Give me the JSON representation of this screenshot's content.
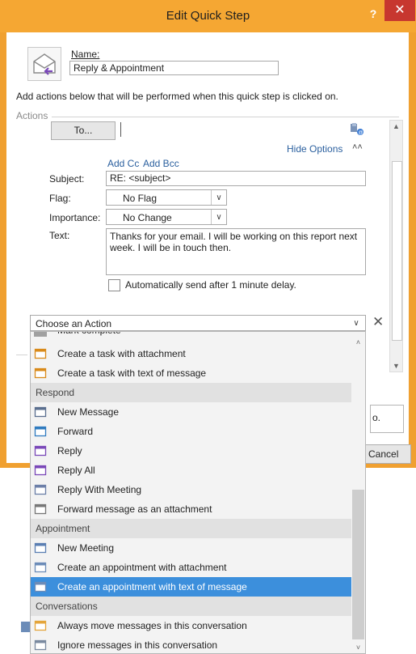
{
  "window": {
    "title": "Edit Quick Step",
    "help_label": "?",
    "close_label": "✕"
  },
  "name": {
    "label": "Name:",
    "value": "Reply & Appointment"
  },
  "instructions": "Add actions below that will be performed when this quick step is clicked on.",
  "actions_label": "Actions",
  "to_button": "To...",
  "hide_options": "Hide Options",
  "add_cc": "Add Cc",
  "add_bcc": "Add Bcc",
  "subject": {
    "label": "Subject:",
    "value": "RE: <subject>"
  },
  "flag": {
    "label": "Flag:",
    "value": "No Flag"
  },
  "importance": {
    "label": "Importance:",
    "value": "No Change"
  },
  "text": {
    "label": "Text:",
    "value": "Thanks for your email. I will be working on this report next week. I will be in touch then."
  },
  "auto_send": {
    "label": "Automatically send after 1 minute delay.",
    "checked": false
  },
  "choose_action": {
    "value": "Choose an Action",
    "remove_label": "✕"
  },
  "partial_text": {
    "text_o": "o.",
    "cancel": "Cancel"
  },
  "dropdown": {
    "cut_item": "Mark complete",
    "items": [
      {
        "type": "item",
        "label": "Create a task with attachment",
        "icon": "task-attachment-icon",
        "color": "#d98a1a"
      },
      {
        "type": "item",
        "label": "Create a task with text of message",
        "icon": "task-text-icon",
        "color": "#d98a1a"
      },
      {
        "type": "header",
        "label": "Respond"
      },
      {
        "type": "item",
        "label": "New Message",
        "icon": "new-message-icon",
        "color": "#5a6f8f"
      },
      {
        "type": "item",
        "label": "Forward",
        "icon": "forward-icon",
        "color": "#2f7bbf"
      },
      {
        "type": "item",
        "label": "Reply",
        "icon": "reply-icon",
        "color": "#7a48b8"
      },
      {
        "type": "item",
        "label": "Reply All",
        "icon": "reply-all-icon",
        "color": "#7a48b8"
      },
      {
        "type": "item",
        "label": "Reply With Meeting",
        "icon": "reply-meeting-icon",
        "color": "#6c7fa8"
      },
      {
        "type": "item",
        "label": "Forward message as an attachment",
        "icon": "forward-attachment-icon",
        "color": "#777777"
      },
      {
        "type": "header",
        "label": "Appointment"
      },
      {
        "type": "item",
        "label": "New Meeting",
        "icon": "new-meeting-icon",
        "color": "#5b7fb3"
      },
      {
        "type": "item",
        "label": "Create an appointment with attachment",
        "icon": "appointment-attachment-icon",
        "color": "#6c8cb8"
      },
      {
        "type": "item",
        "label": "Create an appointment with text of message",
        "icon": "appointment-text-icon",
        "color": "#6c8cb8",
        "selected": true
      },
      {
        "type": "header",
        "label": "Conversations"
      },
      {
        "type": "item",
        "label": "Always move messages in this conversation",
        "icon": "move-conversation-icon",
        "color": "#e4a53a"
      },
      {
        "type": "item",
        "label": "Ignore messages in this conversation",
        "icon": "ignore-conversation-icon",
        "color": "#7a8aa0"
      }
    ]
  },
  "colors": {
    "accent": "#f5a733",
    "close": "#c7372f",
    "link": "#2a5f9e",
    "selection": "#3c8fdc"
  }
}
